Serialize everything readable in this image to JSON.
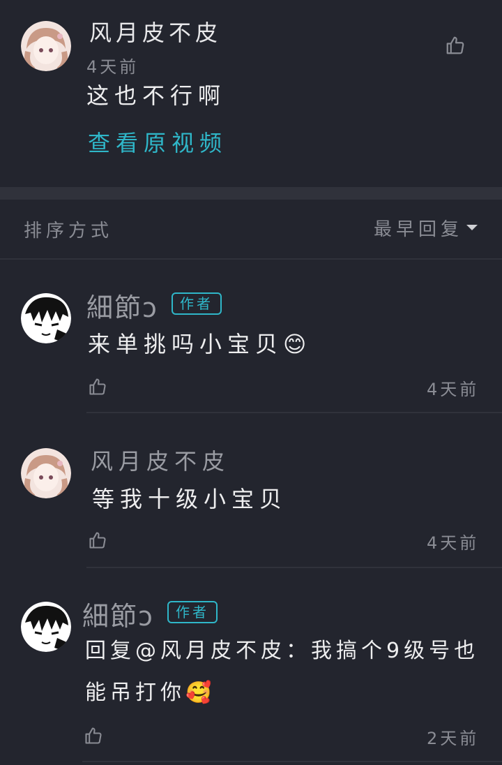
{
  "header_comment": {
    "name": "风月皮不皮",
    "time": "4天前",
    "text": "这也不行啊",
    "link": "查看原视频"
  },
  "sort": {
    "label": "排序方式",
    "selected": "最早回复"
  },
  "replies": [
    {
      "name": "細節ↄ",
      "badge": "作者",
      "text": "来单挑吗小宝贝😊",
      "time": "4天前"
    },
    {
      "name": "风月皮不皮",
      "text": "等我十级小宝贝",
      "time": "4天前"
    },
    {
      "name": "細節ↄ",
      "badge": "作者",
      "text_line1": "回复@风月皮不皮：我搞个9级号也",
      "text_line2": "能吊打你🥰",
      "time": "2天前"
    }
  ],
  "colors": {
    "background": "#23252e",
    "accent": "#2fb7c9",
    "muted": "#8a8c94"
  }
}
